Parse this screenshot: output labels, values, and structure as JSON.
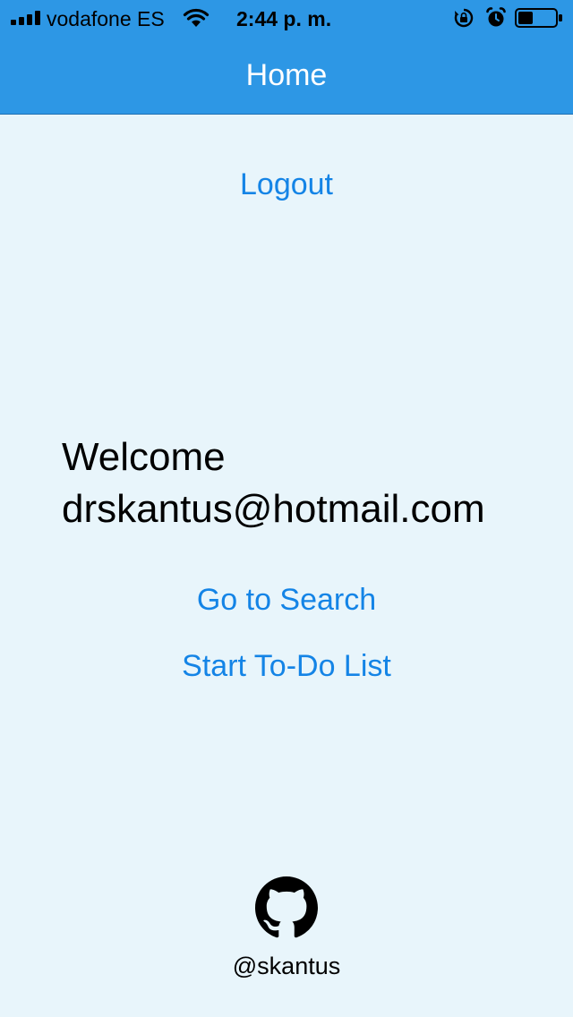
{
  "status_bar": {
    "carrier": "vodafone ES",
    "time": "2:44 p. m.",
    "icons": [
      "cellular-signal-icon",
      "wifi-icon",
      "orientation-lock-icon",
      "alarm-icon",
      "battery-icon"
    ],
    "battery_level": 0.4
  },
  "nav": {
    "title": "Home"
  },
  "actions": {
    "logout_label": "Logout",
    "go_to_search_label": "Go to Search",
    "start_todo_label": "Start To-Do List"
  },
  "welcome": {
    "greeting": "Welcome",
    "email": "drskantus@hotmail.com"
  },
  "footer": {
    "icon": "github-icon",
    "handle": "@skantus"
  },
  "colors": {
    "header_bg": "#2d97e5",
    "page_bg": "#e8f5fb",
    "link": "#1484e6",
    "title_text": "#ffffff",
    "body_text": "#000000"
  }
}
